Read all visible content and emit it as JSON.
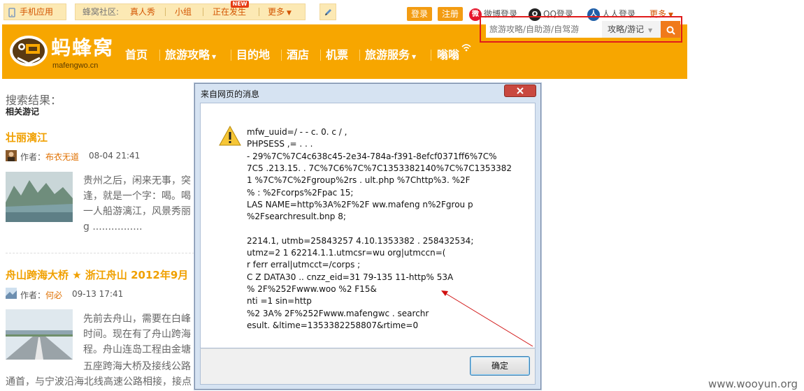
{
  "topbar": {
    "mobile_app": "手机应用",
    "community_label": "蜂窝社区:",
    "community_links": [
      "真人秀",
      "小组",
      "正在发生",
      "更多"
    ],
    "new_badge": "NEW",
    "login": "登录",
    "register": "注册",
    "weibo_login": "微博登录",
    "qq_login": "QQ登录",
    "renren_login": "人人登录",
    "more": "更多"
  },
  "header": {
    "logo_text": "蚂蜂窝",
    "logo_domain": "mafengwo.cn",
    "nav": [
      "首页",
      "旅游攻略",
      "目的地",
      "酒店",
      "机票",
      "旅游服务",
      "嗡嗡"
    ],
    "search_placeholder": "旅游攻略/自助游/自驾游",
    "search_category": "攻略/游记",
    "brand_color": "#f7a600"
  },
  "results": {
    "heading": "搜索结果：",
    "subheading": "相关游记",
    "items": [
      {
        "title": "壮丽漓江",
        "author_label": "作者：",
        "author": "布衣无道",
        "date": "08-04 21:41",
        "excerpt": [
          "贵州之后，闲来无事，突",
          "逢，就是一个字：喝。喝",
          "一人船游漓江，风景秀丽",
          "g ................"
        ]
      },
      {
        "title": "舟山跨海大桥 ★ 浙江舟山 2012年9月",
        "author_label": "作者：",
        "author": "何必",
        "date": "09-13 17:41",
        "excerpt": [
          "先前去舟山，需要在白峰",
          "时间。现在有了舟山跨海",
          "程。舟山连岛工程由金塘",
          "五座跨海大桥及接线公路",
          "通首，与宁波沿海北线高速公路相接，接点"
        ]
      }
    ]
  },
  "dialog": {
    "title": "来自网页的消息",
    "icon": "warning-icon",
    "message_lines": [
      "mfw_uuid=/          -          -            c. 0.   c /   ,",
      "PHPSESS   ,=              .    .             .",
      "        -    29%7C%7C4c638c45-2e34-784a-f391-8efcf0371ff6%7C%",
      "7C5  .213.15.   .  7C%7C6%7C%7C1353382140%7C%7C1353382",
      "1      %7C%7C%2Fgroup%2rs          .    ult.php    %7Chttp%3.  %2F",
      "         %      :    %2Fcorps%2Fpac      15;",
      "LAS         NAME=http%3A%2F%2F  ww.mafeng      n%2Fgrou p",
      "%2Fsearchresult.bnp       8;",
      "",
      "2214.1,   utmb=25843257   4.10.1353382    .           258432534;",
      "   utmz=2         1      62214.1.1.utmcsr=wu          org|utmccn=(",
      "r  ferr           erral|utmcct=/corps         ;",
      "C  Z  DATA30    ..    cnzz_eid=31    79-135          11-http%   53A",
      "%   2F%252Fwww.woo                                    %2  F15&",
      "nti    =1                                                     sin=http",
      "%2  3A%   2F%252Fwww.mafengwc              .          searchr",
      "esult.     &ltime=1353382258807&rtime=0"
    ],
    "ok": "确定"
  },
  "watermark": "www.wooyun.org"
}
